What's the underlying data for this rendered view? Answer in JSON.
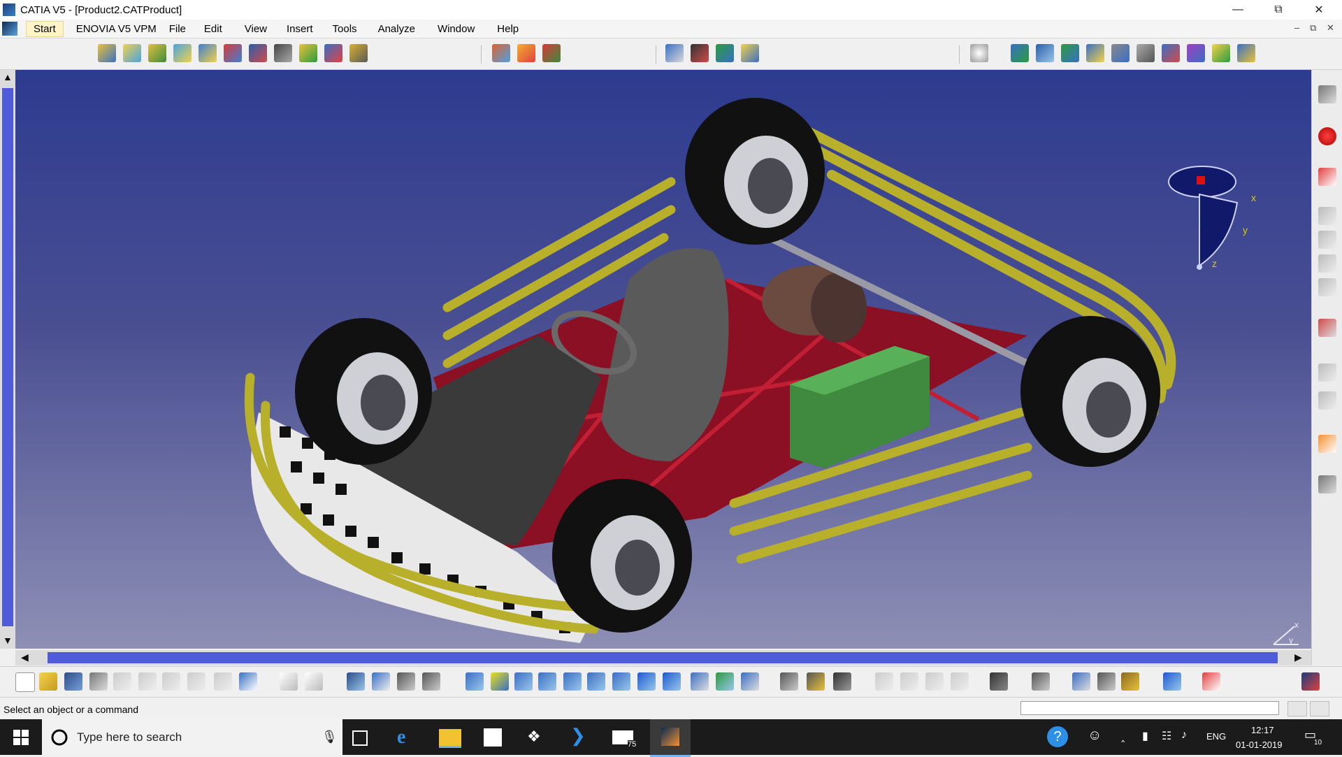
{
  "window": {
    "title": "CATIA V5 - [Product2.CATProduct]",
    "minimize_icon": "minimize-icon",
    "restore_icon": "restore-icon",
    "close_icon": "close-icon"
  },
  "menu": {
    "items": [
      "Start",
      "ENOVIA V5 VPM",
      "File",
      "Edit",
      "View",
      "Insert",
      "Tools",
      "Analyze",
      "Window",
      "Help"
    ]
  },
  "viewport": {
    "compass_labels": {
      "x": "x",
      "y": "y",
      "z": "z"
    },
    "corner_axis": {
      "x": "x",
      "y": "y"
    },
    "colors": {
      "background_top": "#2d3b8f",
      "background_bottom": "#8e8fb5",
      "frame": "#b8b02a",
      "chassis": "#8c1024",
      "tire": "#111111",
      "seat": "#5a5a5a",
      "battery": "#3f8a3f"
    }
  },
  "status": {
    "message": "Select an object or a command",
    "command_input": ""
  },
  "taskbar": {
    "search_placeholder": "Type here to search",
    "mail_badge": "75",
    "language": "ENG",
    "time": "12:17",
    "date": "01-01-2019",
    "notification_count": "10"
  }
}
